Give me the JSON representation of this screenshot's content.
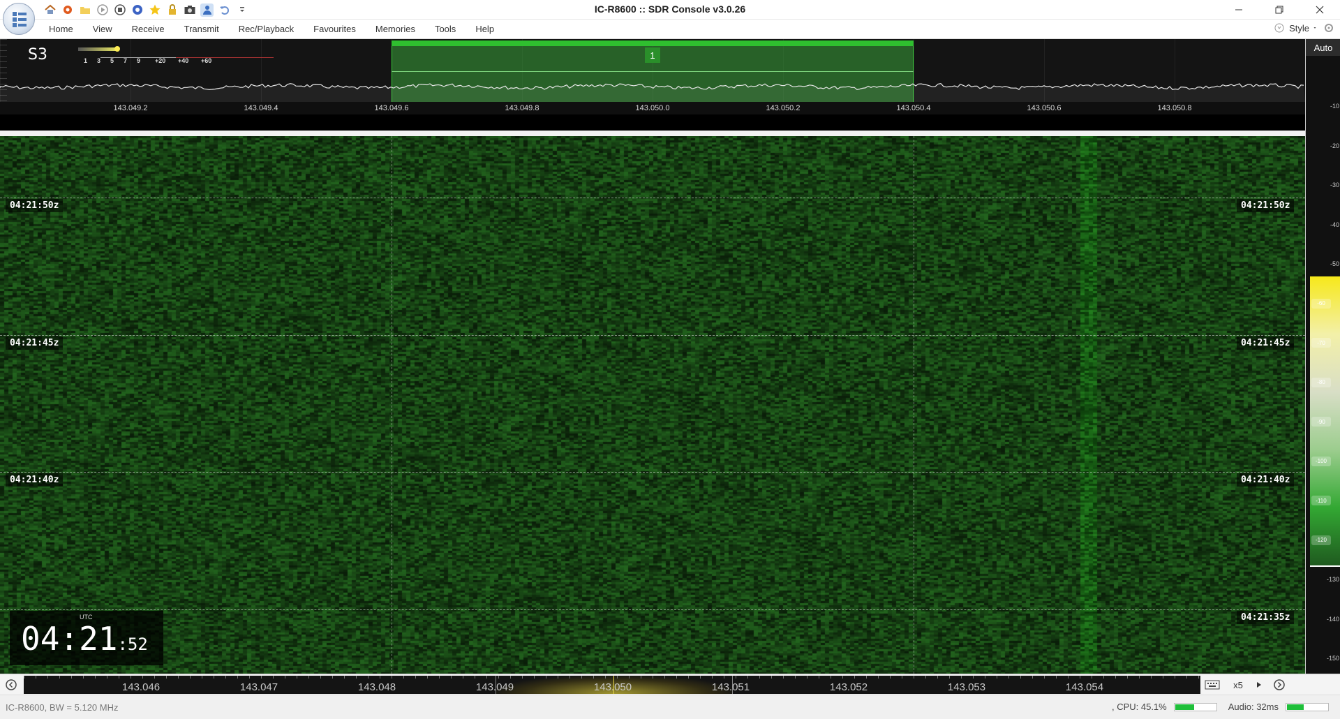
{
  "window": {
    "title": "IC-R8600 :: SDR Console v3.0.26"
  },
  "quick_access": [
    "home-icon",
    "settings-icon",
    "folder-icon",
    "play-icon",
    "stop-icon",
    "record-icon",
    "star-icon",
    "lock-icon",
    "camera-icon",
    "person-icon",
    "undo-icon",
    "customize-dropdown-icon"
  ],
  "menu": [
    "Home",
    "View",
    "Receive",
    "Transmit",
    "Rec/Playback",
    "Favourites",
    "Memories",
    "Tools",
    "Help"
  ],
  "style_label": "Style",
  "spectrum": {
    "s_meter": "S3",
    "s_scale": [
      "1",
      "3",
      "5",
      "7",
      "9",
      "+20",
      "+40",
      "+60"
    ],
    "vfo_marker": "1",
    "freq_labels": [
      "143.049.2",
      "143.049.4",
      "143.049.6",
      "143.049.8",
      "143.050.0",
      "143.050.2",
      "143.050.4",
      "143.050.6",
      "143.050.8"
    ]
  },
  "waterfall": {
    "time_labels": [
      "04:21:50z",
      "04:21:45z",
      "04:21:40z",
      "04:21:35z"
    ],
    "clock": {
      "zone": "UTC",
      "hm": "04:21",
      "sec": ":52"
    }
  },
  "scale": {
    "auto_label": "Auto",
    "labels": [
      "-10",
      "-20",
      "-30",
      "-40",
      "-50",
      "-60",
      "-70",
      "-80",
      "-90",
      "-100",
      "-110",
      "-120",
      "-130",
      "-140",
      "-150"
    ]
  },
  "tuning": {
    "freq_labels": [
      "143.046",
      "143.047",
      "143.048",
      "143.049",
      "143.050",
      "143.051",
      "143.052",
      "143.053",
      "143.054"
    ],
    "zoom": "x5"
  },
  "status": {
    "left": "IC-R8600, BW = 5.120 MHz",
    "cpu": ", CPU: 45.1%",
    "audio": "Audio: 32ms"
  },
  "meters": {
    "cpu_fill": 0.451,
    "audio_fill": 0.4
  },
  "colors": {
    "accent": "#2fbf2f",
    "waterfall": "#1b3a1b"
  }
}
